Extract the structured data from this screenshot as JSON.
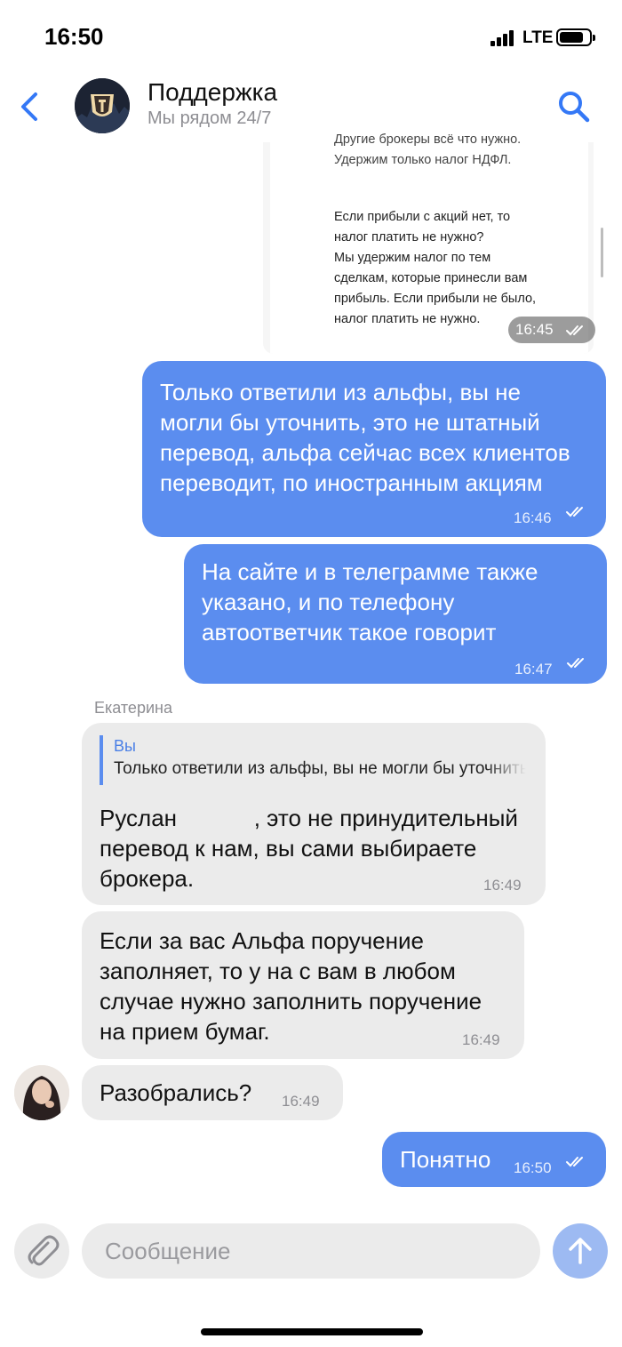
{
  "status_bar": {
    "time": "16:50",
    "network": "LTE"
  },
  "header": {
    "title": "Поддержка",
    "subtitle": "Мы рядом 24/7"
  },
  "image_message": {
    "text_top": "Другие брокеры всё что нужно.\nУдержим только налог НДФЛ.",
    "text_body": "Если прибыли с акций нет, то\nналог платить не нужно?\nМы удержим налог по тем\nсделкам, которые принесли вам\nприбыль. Если прибыли не было,\nналог платить не нужно.",
    "time": "16:45"
  },
  "messages": [
    {
      "id": "m1",
      "direction": "out",
      "text": "Только ответили из альфы, вы не могли бы уточнить, это не штатный перевод, альфа сейчас всех клиентов переводит, по иностранным акциям",
      "time": "16:46"
    },
    {
      "id": "m2",
      "direction": "out",
      "text": "На сайте и в телеграмме также указано, и по телефону автоответчик такое говорит",
      "time": "16:47"
    },
    {
      "id": "m3",
      "direction": "in",
      "sender": "Екатерина",
      "reply_author": "Вы",
      "reply_text": "Только ответили из альфы, вы не могли бы уточнить, это не штатный перевод",
      "text": "Руслан            , это не принудительный перевод к нам, вы сами выбираете брокера.",
      "time": "16:49"
    },
    {
      "id": "m4",
      "direction": "in",
      "text": "Если за вас Альфа поручение заполняет, то у на с вам в любом случае нужно заполнить поручение на прием бумаг.",
      "time": "16:49"
    },
    {
      "id": "m5",
      "direction": "in",
      "text": "Разобрались?",
      "time": "16:49"
    },
    {
      "id": "m6",
      "direction": "out",
      "text": "Понятно",
      "time": "16:50"
    }
  ],
  "composer": {
    "placeholder": "Сообщение"
  },
  "colors": {
    "accent": "#3478f6",
    "outgoing_bubble": "#5b8def",
    "incoming_bubble": "#ebebeb"
  }
}
